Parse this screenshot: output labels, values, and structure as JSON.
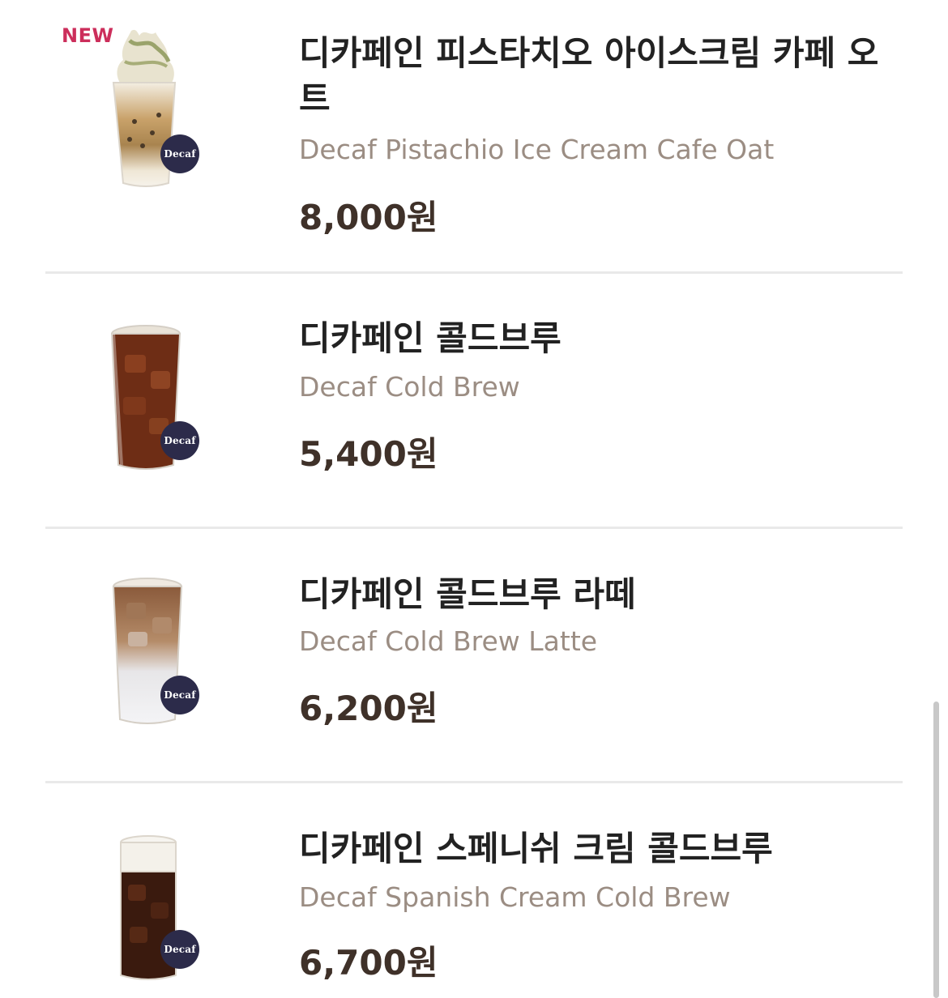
{
  "menu": {
    "items": [
      {
        "new_badge": "NEW",
        "name_ko": "디카페인 피스타치오 아이스크림 카페 오트",
        "name_en": "Decaf Pistachio Ice Cream Cafe Oat",
        "price": "8,000원",
        "badge": "Decaf",
        "drink_icon": "pistachio-ice-cream-drink-icon"
      },
      {
        "name_ko": "디카페인 콜드브루",
        "name_en": "Decaf Cold Brew",
        "price": "5,400원",
        "badge": "Decaf",
        "drink_icon": "cold-brew-drink-icon"
      },
      {
        "name_ko": "디카페인 콜드브루 라떼",
        "name_en": "Decaf Cold Brew Latte",
        "price": "6,200원",
        "badge": "Decaf",
        "drink_icon": "cold-brew-latte-drink-icon"
      },
      {
        "name_ko": "디카페인 스페니쉬 크림 콜드브루",
        "name_en": "Decaf Spanish Cream Cold Brew",
        "price": "6,700원",
        "badge": "Decaf",
        "drink_icon": "spanish-cream-cold-brew-drink-icon"
      }
    ]
  },
  "colors": {
    "new_badge": "#cc2e5b",
    "title": "#222222",
    "subtitle": "#9b8d83",
    "price": "#3f3129",
    "decaf_badge": "#2c2b4a",
    "divider": "#e9e9e9"
  }
}
